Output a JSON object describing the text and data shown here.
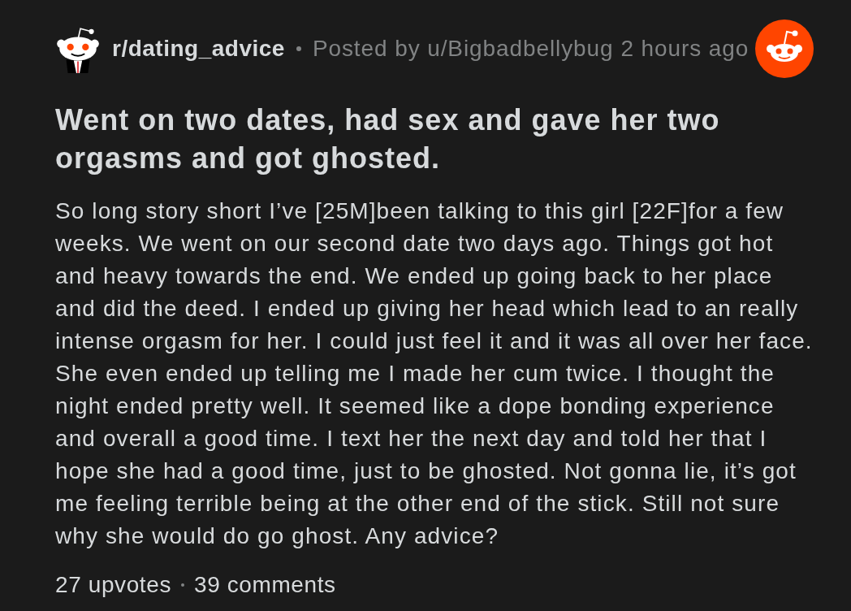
{
  "post": {
    "subreddit": "r/dating_advice",
    "byline": "Posted by u/Bigbadbellybug",
    "time": "2 hours ago",
    "title": "Went on two dates, had sex and gave her two orgasms and got ghosted.",
    "body": "So long story short I’ve [25M]been talking to this girl [22F]for a few weeks. We went on our second date two days ago. Things got hot and heavy towards the end. We ended up going back to her place and did the deed. I ended up giving her head which lead to an really intense orgasm for her. I could just feel it and it was all over her face. She even ended up telling me I made her cum twice. I thought the night ended pretty well. It seemed like a dope bonding experience and overall a good time. I text her the next day and told her that I hope she had a good time, just to be ghosted. Not gonna lie, it’s got me feeling terrible being at the other end of the stick. Still not sure why she would do go ghost. Any advice?",
    "upvotes": "27 upvotes",
    "comments": "39 comments"
  }
}
